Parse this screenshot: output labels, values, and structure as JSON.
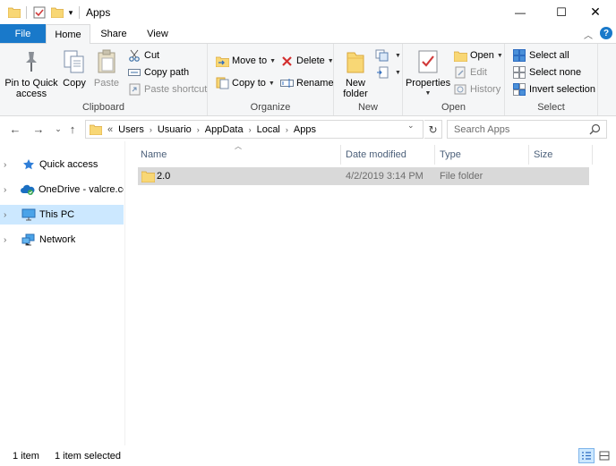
{
  "window": {
    "title": "Apps",
    "controls": {
      "minimize": "—",
      "maximize": "☐",
      "close": "✕"
    }
  },
  "ribbon_tabs": [
    {
      "label": "File"
    },
    {
      "label": "Home"
    },
    {
      "label": "Share"
    },
    {
      "label": "View"
    }
  ],
  "ribbon": {
    "clipboard": {
      "label": "Clipboard",
      "pin": "Pin to Quick access",
      "copy": "Copy",
      "paste": "Paste",
      "cut": "Cut",
      "copy_path": "Copy path",
      "paste_shortcut": "Paste shortcut"
    },
    "organize": {
      "label": "Organize",
      "move_to": "Move to",
      "copy_to": "Copy to",
      "delete": "Delete",
      "rename": "Rename"
    },
    "new": {
      "label": "New",
      "new_folder": "New folder"
    },
    "open": {
      "label": "Open",
      "properties": "Properties",
      "open": "Open",
      "edit": "Edit",
      "history": "History"
    },
    "select": {
      "label": "Select",
      "select_all": "Select all",
      "select_none": "Select none",
      "invert": "Invert selection"
    }
  },
  "address": {
    "overflow": "«",
    "breadcrumbs": [
      "Users",
      "Usuario",
      "AppData",
      "Local",
      "Apps"
    ],
    "search_placeholder": "Search Apps"
  },
  "nav_pane": [
    {
      "label": "Quick access",
      "icon": "star-icon"
    },
    {
      "label": "OneDrive - valcre.cor",
      "icon": "cloud-icon"
    },
    {
      "label": "This PC",
      "icon": "pc-icon",
      "selected": true
    },
    {
      "label": "Network",
      "icon": "network-icon"
    }
  ],
  "file_list": {
    "columns": [
      "Name",
      "Date modified",
      "Type",
      "Size"
    ],
    "rows": [
      {
        "name": "2.0",
        "date": "4/2/2019 3:14 PM",
        "type": "File folder",
        "size": ""
      }
    ]
  },
  "status": {
    "item_count": "1 item",
    "selected_count": "1 item selected"
  },
  "colors": {
    "accent": "#1979ca",
    "selection": "#cce8ff",
    "row_selected": "#d9d9d9",
    "folder": "#f8d775"
  }
}
